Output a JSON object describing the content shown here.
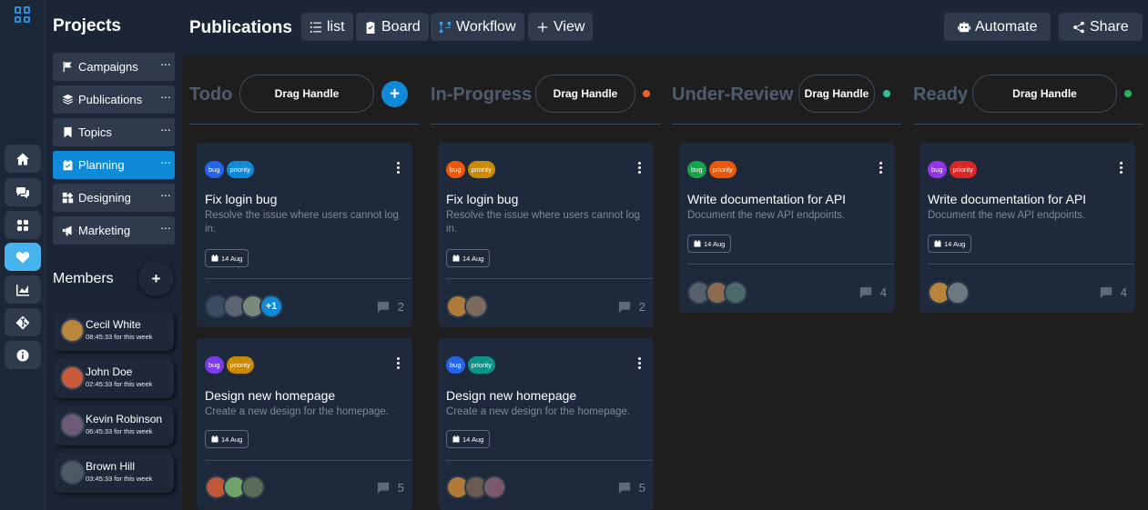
{
  "rail": {
    "logo_icon": "grid-icon",
    "buttons": [
      {
        "icon": "home-icon"
      },
      {
        "icon": "chat-icon"
      },
      {
        "icon": "apps-icon"
      },
      {
        "icon": "heart-icon",
        "active": true
      },
      {
        "icon": "chart-icon"
      },
      {
        "icon": "git-icon"
      },
      {
        "icon": "info-icon"
      }
    ]
  },
  "projects": {
    "title": "Projects",
    "items": [
      {
        "label": "Campaigns",
        "icon": "flag-icon"
      },
      {
        "label": "Publications",
        "icon": "layers-icon"
      },
      {
        "label": "Topics",
        "icon": "bookmark-icon"
      },
      {
        "label": "Planning",
        "icon": "calendar-icon",
        "active": true
      },
      {
        "label": "Designing",
        "icon": "design-icon"
      },
      {
        "label": "Marketing",
        "icon": "megaphone-icon"
      }
    ],
    "more_label": "···"
  },
  "members": {
    "title": "Members",
    "add_label": "+",
    "list": [
      {
        "name": "Cecil White",
        "time": "08:45:33 for this week",
        "avatar_color": "#b7863f"
      },
      {
        "name": "John Doe",
        "time": "02:45:33 for this week",
        "avatar_color": "#c65a3b"
      },
      {
        "name": "Kevin Robinson",
        "time": "06:45:33 for this week",
        "avatar_color": "#6b5a78"
      },
      {
        "name": "Brown Hill",
        "time": "03:45:33 for this week",
        "avatar_color": "#4d5a66"
      }
    ]
  },
  "header": {
    "title": "Publications",
    "buttons": [
      {
        "label": "list",
        "icon": "list-icon"
      },
      {
        "label": "Board",
        "icon": "clipboard-icon"
      },
      {
        "label": "Workflow",
        "icon": "workflow-icon"
      },
      {
        "label": "View",
        "icon": "plus-icon"
      }
    ],
    "automate_label": "Automate",
    "share_label": "Share"
  },
  "columns": [
    {
      "title": "Todo",
      "handle": "Drag Handle",
      "add_label": "+"
    },
    {
      "title": "In-Progress",
      "handle": "Drag Handle",
      "status_color": "#e8622a"
    },
    {
      "title": "Under-Review",
      "handle": "Drag Handle",
      "status_color": "#2fbf9f"
    },
    {
      "title": "Ready",
      "handle": "Drag Handle",
      "status_color": "#2fb35a"
    }
  ],
  "cards": [
    {
      "tags": [
        {
          "label": "bug",
          "color": "#2563eb"
        },
        {
          "label": "priority",
          "color": "#0f8ad8"
        }
      ],
      "title": "Fix login bug",
      "desc": "Resolve the issue where users cannot log in.",
      "date": "14 Aug",
      "comments": "2",
      "more": "+1",
      "avatars": [
        "#3d4c63",
        "#5b6470",
        "#7a8a7a"
      ]
    },
    {
      "tags": [
        {
          "label": "bug",
          "color": "#ea580c"
        },
        {
          "label": "priority",
          "color": "#ca8a04"
        }
      ],
      "title": "Fix login bug",
      "desc": "Resolve the issue where users cannot log in.",
      "date": "14 Aug",
      "comments": "2",
      "avatars": [
        "#b07a3a",
        "#7b6a5e"
      ]
    },
    {
      "tags": [
        {
          "label": "bug",
          "color": "#16a34a"
        },
        {
          "label": "priority",
          "color": "#ea580c"
        }
      ],
      "title": "Write documentation for API",
      "desc": "Document the new API endpoints.",
      "date": "14 Aug",
      "comments": "4",
      "avatars": [
        "#55606b",
        "#8a6b4f",
        "#4a6a6a"
      ]
    },
    {
      "tags": [
        {
          "label": "bug",
          "color": "#9333ea"
        },
        {
          "label": "priority",
          "color": "#dc2626"
        }
      ],
      "title": "Write documentation for API",
      "desc": "Document the new API endpoints.",
      "date": "14 Aug",
      "comments": "4",
      "avatars": [
        "#b8843c",
        "#6b7a82"
      ]
    },
    {
      "tags": [
        {
          "label": "bug",
          "color": "#7c3aed"
        },
        {
          "label": "priority",
          "color": "#ca8a04"
        }
      ],
      "title": "Design new homepage",
      "desc": "Create a new design for the homepage.",
      "date": "14 Aug",
      "comments": "5",
      "avatars": [
        "#c0573a",
        "#6fa36a",
        "#5a6b5a"
      ]
    },
    {
      "tags": [
        {
          "label": "bug",
          "color": "#2563eb"
        },
        {
          "label": "priority",
          "color": "#0d9488"
        }
      ],
      "title": "Design new homepage",
      "desc": "Create a new design for the homepage.",
      "date": "14 Aug",
      "comments": "5",
      "avatars": [
        "#b07a3a",
        "#6b5a4f",
        "#7a5a6a"
      ]
    }
  ]
}
